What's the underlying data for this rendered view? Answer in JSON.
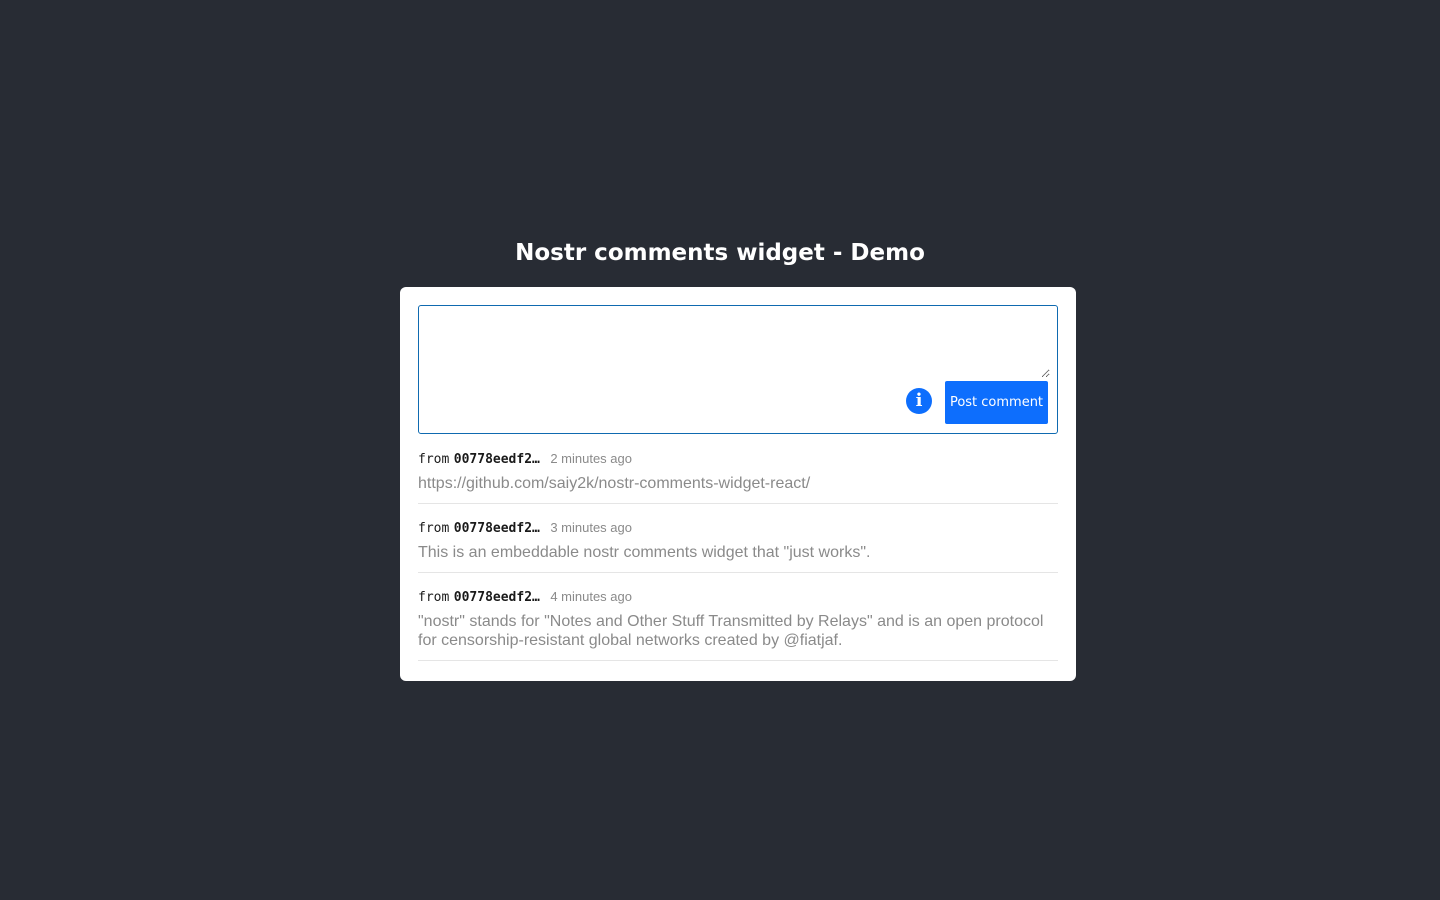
{
  "page": {
    "title": "Nostr comments widget - Demo"
  },
  "composer": {
    "placeholder": "",
    "value": "",
    "info_icon": "info-icon",
    "post_label": "Post comment"
  },
  "colors": {
    "background": "#282c34",
    "accent": "#0d6efd"
  },
  "comments": [
    {
      "from_label": "from",
      "author": "00778eedf2…",
      "time": "2 minutes ago",
      "text": "https://github.com/saiy2k/nostr-comments-widget-react/"
    },
    {
      "from_label": "from",
      "author": "00778eedf2…",
      "time": "3 minutes ago",
      "text": "This is an embeddable nostr comments widget that \"just works\"."
    },
    {
      "from_label": "from",
      "author": "00778eedf2…",
      "time": "4 minutes ago",
      "text": "\"nostr\" stands for \"Notes and Other Stuff Transmitted by Relays\" and is an open protocol for censorship-resistant global networks created by @fiatjaf."
    }
  ]
}
